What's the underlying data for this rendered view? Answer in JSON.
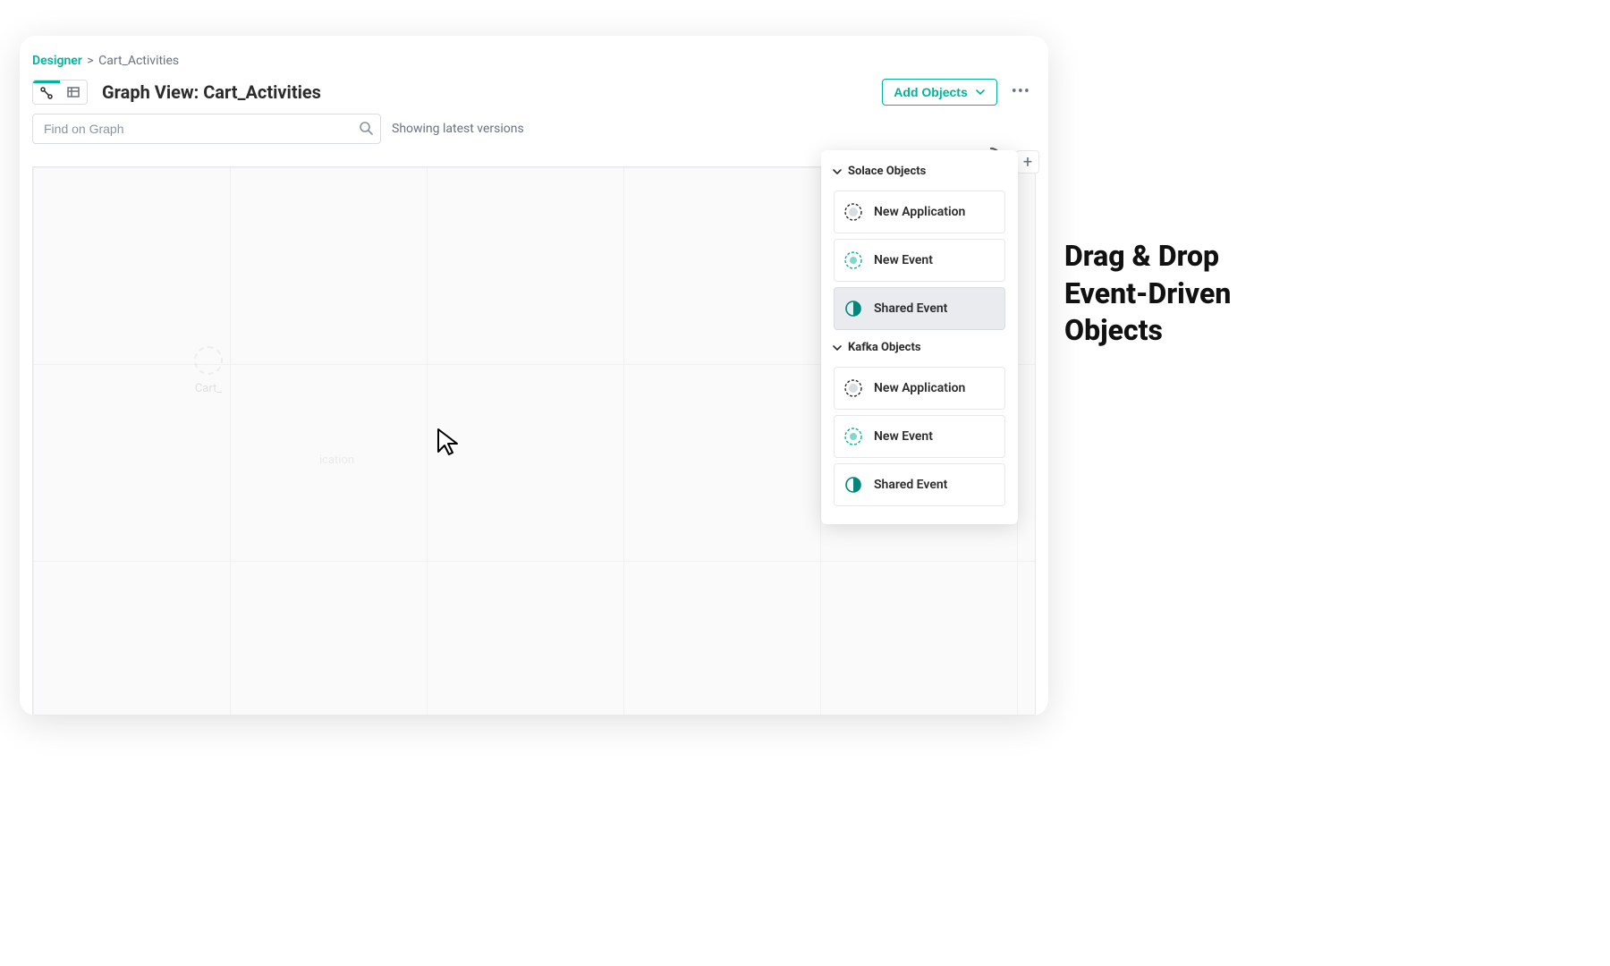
{
  "breadcrumb": {
    "root": "Designer",
    "current": "Cart_Activities"
  },
  "header": {
    "title": "Graph View: Cart_Activities",
    "add_objects_label": "Add Objects"
  },
  "search": {
    "placeholder": "Find on Graph"
  },
  "filter": {
    "showing": "Showing latest versions"
  },
  "canvas": {
    "ghost_label": "Cart_",
    "ghost_label2": "ication"
  },
  "dropdown": {
    "groups": [
      {
        "title": "Solace Objects",
        "items": [
          {
            "label": "New Application",
            "icon": "application",
            "highlight": false
          },
          {
            "label": "New Event",
            "icon": "event",
            "highlight": false
          },
          {
            "label": "Shared Event",
            "icon": "shared",
            "highlight": true
          }
        ]
      },
      {
        "title": "Kafka Objects",
        "items": [
          {
            "label": "New Application",
            "icon": "application",
            "highlight": false
          },
          {
            "label": "New Event",
            "icon": "event",
            "highlight": false
          },
          {
            "label": "Shared Event",
            "icon": "shared",
            "highlight": false
          }
        ]
      }
    ]
  },
  "callout": {
    "line1": "Drag & Drop",
    "line2": "Event-Driven",
    "line3": "Objects"
  },
  "colors": {
    "accent": "#00B49C",
    "text_muted": "#6b7280"
  }
}
